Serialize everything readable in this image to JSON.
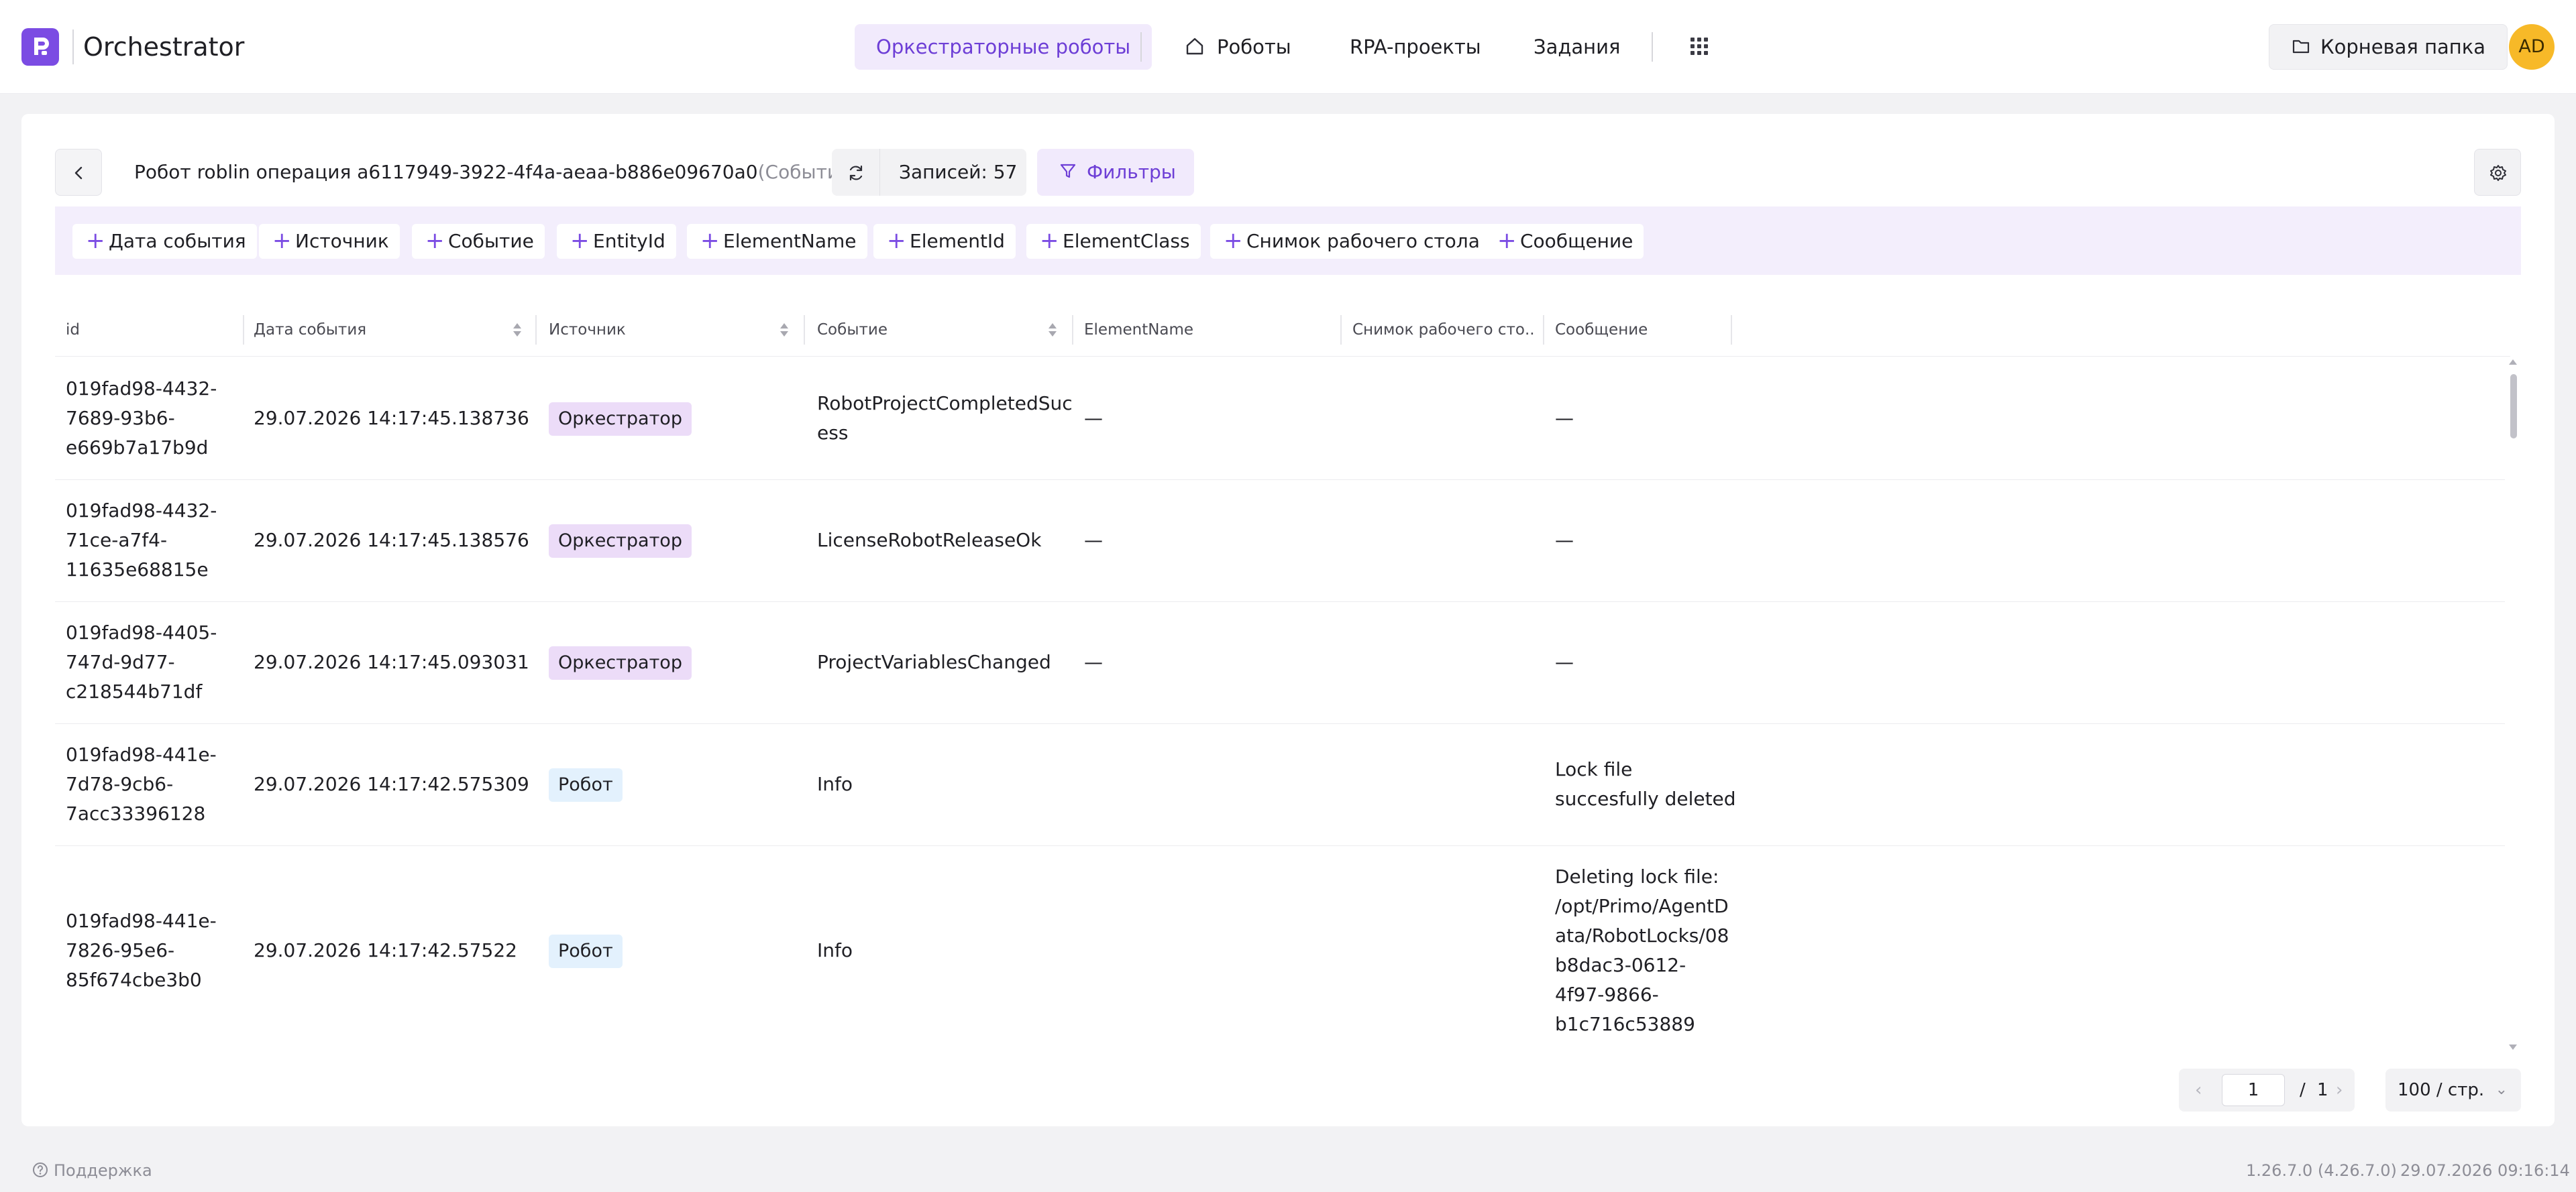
{
  "app": {
    "title": "Orchestrator",
    "logo_icon": "primo-logo-icon",
    "accent_color": "#7b4ce3"
  },
  "nav": {
    "active": "Оркестраторные роботы",
    "items": [
      "Роботы",
      "RPA-проекты",
      "Задания"
    ],
    "apps_icon": "grid-icon"
  },
  "header_right": {
    "folder_label": "Корневая папка",
    "avatar_initials": "AD"
  },
  "page": {
    "title": "Робот roblin операция a6117949-3922-4f4a-aeaa-b886e09670a0",
    "title_suffix": "(События)",
    "records_label": "Записей: 57",
    "filters_label": "Фильтры"
  },
  "chips": [
    "Дата события",
    "Источник",
    "Событие",
    "EntityId",
    "ElementName",
    "ElementId",
    "ElementClass",
    "Снимок рабочего стола",
    "Сообщение"
  ],
  "table": {
    "columns": [
      "id",
      "Дата события",
      "Источник",
      "Событие",
      "ElementName",
      "Снимок рабочего сто...",
      "Сообщение"
    ],
    "rows": [
      {
        "id": "019fad98-4432-\n7689-93b6-\ne669b7a17b9d",
        "date": "29.07.2026 14:17:45.138736",
        "source": "Оркестратор",
        "source_kind": "orch",
        "event": "RobotProjectCompletedSucc\ness",
        "element_name": "—",
        "snapshot": "",
        "message": "—"
      },
      {
        "id": "019fad98-4432-\n71ce-a7f4-\n11635e68815e",
        "date": "29.07.2026 14:17:45.138576",
        "source": "Оркестратор",
        "source_kind": "orch",
        "event": "LicenseRobotReleaseOk",
        "element_name": "—",
        "snapshot": "",
        "message": "—"
      },
      {
        "id": "019fad98-4405-\n747d-9d77-\nc218544b71df",
        "date": "29.07.2026 14:17:45.093031",
        "source": "Оркестратор",
        "source_kind": "orch",
        "event": "ProjectVariablesChanged",
        "element_name": "—",
        "snapshot": "",
        "message": "—"
      },
      {
        "id": "019fad98-441e-\n7d78-9cb6-\n7acc33396128",
        "date": "29.07.2026 14:17:42.575309",
        "source": "Робот",
        "source_kind": "robot",
        "event": "Info",
        "element_name": "",
        "snapshot": "",
        "message": "Lock file\nsuccesfully deleted"
      },
      {
        "id": "019fad98-441e-\n7826-95e6-\n85f674cbe3b0",
        "date": "29.07.2026 14:17:42.57522",
        "source": "Робот",
        "source_kind": "robot",
        "event": "Info",
        "element_name": "",
        "snapshot": "",
        "message": "Deleting lock file:\n/opt/Primo/AgentD\nata/RobotLocks/08\nb8dac3-0612-\n4f97-9866-\nb1c716c53889"
      }
    ]
  },
  "pagination": {
    "current_page": "1",
    "separator": "/",
    "total_pages": "1",
    "page_size": "100 / стр.",
    "prev_icon": "chevron-left-icon",
    "next_icon": "chevron-right-icon"
  },
  "footer": {
    "support": "Поддержка",
    "version": "1.26.7.0 (4.26.7.0)",
    "date": "29.07.2026 09:16:14"
  }
}
